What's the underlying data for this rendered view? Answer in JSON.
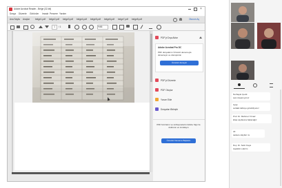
{
  "app": {
    "title": "Adobe Acrobat Reader - Belge (32-bit)",
    "menu": [
      "Dosya",
      "Düzenle",
      "Görünüm",
      "İmzala",
      "Pencere",
      "Yardım"
    ]
  },
  "tabs": [
    "Ana Sayfa",
    "Araçlar",
    "belge1.pdf",
    "belge2.pdf",
    "belge3.pdf",
    "belge4.pdf",
    "belge5.pdf",
    "belge6.pdf",
    "belge7.pdf",
    "belge8.pdf"
  ],
  "toolbar": {
    "page_current": "1",
    "page_total": "/ 1",
    "zoom": "%66",
    "account_label": "Oturum Aç"
  },
  "right_panel": {
    "export_label": "PDF'yi Dışa Aktar",
    "promo_title": "Adobe Acrobat Pro DC",
    "promo_text": "PDF dosyalarını Ücretsiz denemeyle düzenleyin ve dönüştürün",
    "promo_button": "Ücretsiz deneyin",
    "items": [
      {
        "label": "PDF'yi Düzenle",
        "color": "#e24a5a",
        "icon": "edit-pdf-icon"
      },
      {
        "label": "PDF Oluştur",
        "color": "#e24a5a",
        "icon": "create-pdf-icon"
      },
      {
        "label": "Yorum Ekle",
        "color": "#f0a733",
        "icon": "comment-icon"
      },
      {
        "label": "Dosyaları Birleştir",
        "color": "#6a5acd",
        "icon": "combine-files-icon"
      }
    ],
    "footer_text": "PDF formlarını ve sözleşmelerini Adobe Sign ile doldurun ve imzalayın",
    "footer_button": "Ücretsiz Deneme Başlatın"
  },
  "meeting": {
    "chat": [
      {
        "name": "Nurhayat Çevik",
        "text": "sesi duyamıyoruz"
      },
      {
        "name": "Ayşe",
        "text": "soldaki tabloyu görebiliyoruz"
      },
      {
        "name": "Prof. Dr. Mehmet Yılmaz",
        "text": "kitap sayfasına bakacağız"
      },
      {
        "name": "Ali",
        "text": "sadece slaytlar mı"
      },
      {
        "name": "Doç. Dr. Selin Kaya",
        "text": "teşekkür ederim"
      }
    ]
  }
}
